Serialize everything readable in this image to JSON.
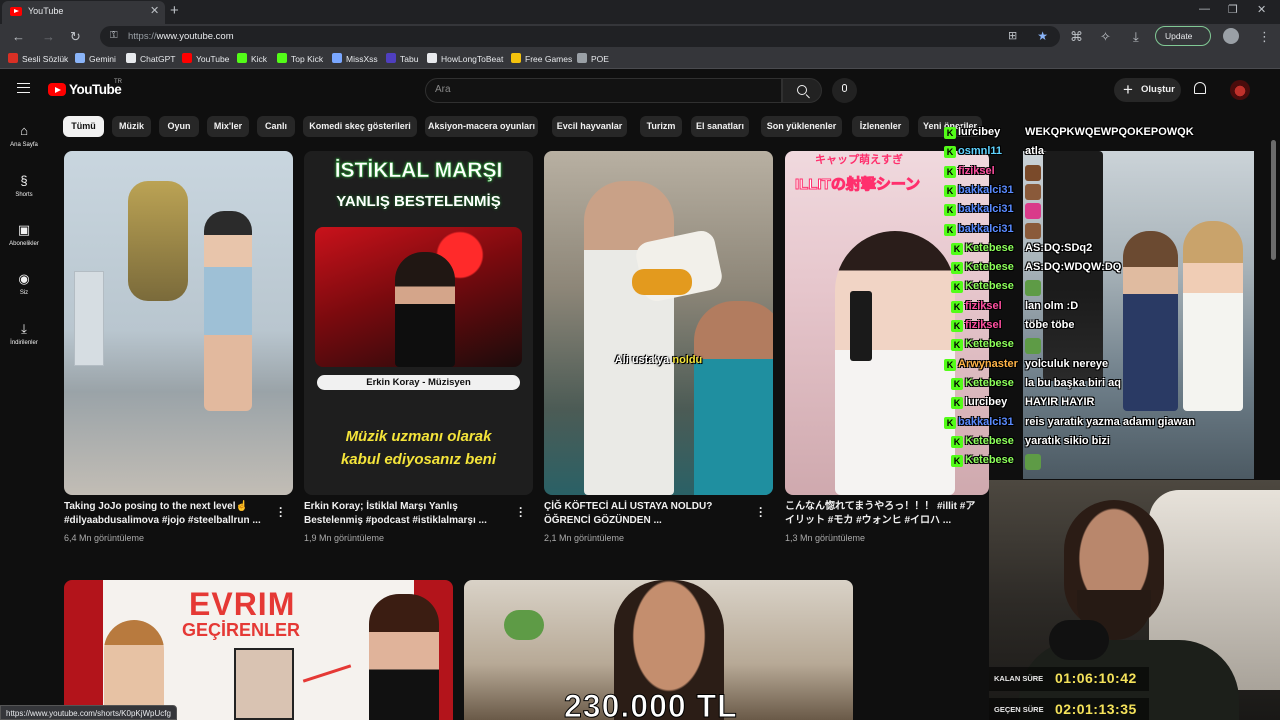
{
  "browser": {
    "tab_title": "YouTube",
    "url_protocol": "https://",
    "url_host": "www.youtube.com",
    "update_label": "Update",
    "bookmarks": [
      {
        "label": "Sesli Sözlük",
        "color": "#d93025"
      },
      {
        "label": "Gemini",
        "color": "#8ab4f8"
      },
      {
        "label": "ChatGPT",
        "color": "#e8eaed"
      },
      {
        "label": "YouTube",
        "color": "#ff0000"
      },
      {
        "label": "Kick",
        "color": "#53fc18"
      },
      {
        "label": "Top Kick",
        "color": "#53fc18"
      },
      {
        "label": "MissXss",
        "color": "#7aa7ff"
      },
      {
        "label": "Tabu",
        "color": "#4f3fbf"
      },
      {
        "label": "HowLongToBeat",
        "color": "#e8eaed"
      },
      {
        "label": "Free Games",
        "color": "#f4c20d"
      },
      {
        "label": "POE",
        "color": "#9aa0a6"
      }
    ],
    "status_url": "https://www.youtube.com/shorts/K0pKjWpUcfg"
  },
  "youtube": {
    "logo_text": "YouTube",
    "logo_tr": "TR",
    "search_placeholder": "Ara",
    "create_label": "Oluştur",
    "sidebar": [
      {
        "label": "Ana Sayfa",
        "icon": "home-icon"
      },
      {
        "label": "Shorts",
        "icon": "shorts-icon"
      },
      {
        "label": "Abonelikler",
        "icon": "subscriptions-icon"
      },
      {
        "label": "Siz",
        "icon": "you-icon"
      },
      {
        "label": "İndirilenler",
        "icon": "downloads-icon"
      }
    ],
    "chips": [
      "Tümü",
      "Müzik",
      "Oyun",
      "Mix'ler",
      "Canlı",
      "Komedi skeç gösterileri",
      "Aksiyon-macera oyunları",
      "Evcil hayvanlar",
      "Turizm",
      "El sanatları",
      "Son yüklenenler",
      "İzlenenler",
      "Yeni öneriler"
    ],
    "videos": [
      {
        "title1": "Taking JoJo posing to the next level☝️",
        "title2": "#dilyaabdusalimova #jojo #steelballrun ...",
        "views": "6,4 Mn görüntüleme"
      },
      {
        "title1": "Erkin Koray; İstiklal Marşı Yanlış",
        "title2": "Bestelenmiş #podcast #istiklalmarşı ...",
        "views": "1,9 Mn görüntüleme",
        "thumb_line1": "İSTİKLAL MARŞI",
        "thumb_line2": "YANLIŞ BESTELENMİŞ",
        "thumb_pill": "Erkin Koray - Müzisyen",
        "thumb_line3a": "Müzik uzmanı olarak",
        "thumb_line3b": "kabul ediyosanız beni"
      },
      {
        "title1": "ÇİĞ KÖFTECİ ALİ USTAYA NOLDU?",
        "title2": "ÖĞRENCİ GÖZÜNDEN ...",
        "views": "2,1 Mn görüntüleme",
        "thumb_caption_a": "Ali usta'ya ",
        "thumb_caption_b": "noldu"
      },
      {
        "title1": "こんなん惚れてまうやろっ！！！ #illit #ア",
        "title2": "イリット #モカ #ウォンヒ #イロハ ...",
        "views": "1,3 Mn görüntüleme",
        "thumb_top": "キャップ萌えすぎ",
        "thumb_big": "ILLITの射撃シーン"
      }
    ],
    "row2": {
      "t5_title": "EVRIM",
      "t5_sub": "GEÇİRENLER",
      "t6_text": "230.000 TL"
    }
  },
  "stream": {
    "chat": [
      {
        "user": "lurcibey",
        "msg": "WEKQPKWQEWPQOKEPOWQK",
        "color": "#ffffff"
      },
      {
        "user": "osmnl11",
        "msg": "atla",
        "color": "#5fd3ff"
      },
      {
        "user": "fiziksel",
        "msg": "",
        "color": "#ff4fa0",
        "emote": "#7a4a2a"
      },
      {
        "user": "bakkalci31",
        "msg": "",
        "color": "#5a8bff",
        "emote": "#8a5a3a"
      },
      {
        "user": "bakkalci31",
        "msg": "",
        "color": "#5a8bff",
        "emote": "#d93a8a"
      },
      {
        "user": "bakkalci31",
        "msg": "",
        "color": "#5a8bff",
        "emote": "#8a5a3a"
      },
      {
        "user": "Ketebese",
        "msg": "AS:DQ:SDq2",
        "color": "#8cff5a"
      },
      {
        "user": "Ketebese",
        "msg": "AS:DQ:WDQW:DQ",
        "color": "#8cff5a"
      },
      {
        "user": "Ketebese",
        "msg": "",
        "color": "#8cff5a",
        "emote": "#5e9b46"
      },
      {
        "user": "fiziksel",
        "msg": "lan olm :D",
        "color": "#ff4fa0"
      },
      {
        "user": "fiziksel",
        "msg": "töbe töbe",
        "color": "#ff4fa0"
      },
      {
        "user": "Ketebese",
        "msg": "",
        "color": "#8cff5a",
        "emote": "#5e9b46"
      },
      {
        "user": "Arwynaster",
        "msg": "yolculuk nereye",
        "color": "#ffb347"
      },
      {
        "user": "Ketebese",
        "msg": "la bu başka biri aq",
        "color": "#8cff5a"
      },
      {
        "user": "lurcibey",
        "msg": "HAYIR HAYIR",
        "color": "#ffffff"
      },
      {
        "user": "bakkalci31",
        "msg": "reis yaratık yazma adamı giawan",
        "color": "#5a8bff"
      },
      {
        "user": "Ketebese",
        "msg": "yaratık sikio bizi",
        "color": "#8cff5a"
      },
      {
        "user": "Ketebese",
        "msg": "",
        "color": "#8cff5a",
        "emote": "#5e9b46"
      }
    ],
    "timers": [
      {
        "label": "KALAN SÜRE",
        "value": "01:06:10:42"
      },
      {
        "label": "GEÇEN SÜRE",
        "value": "02:01:13:35"
      }
    ]
  }
}
